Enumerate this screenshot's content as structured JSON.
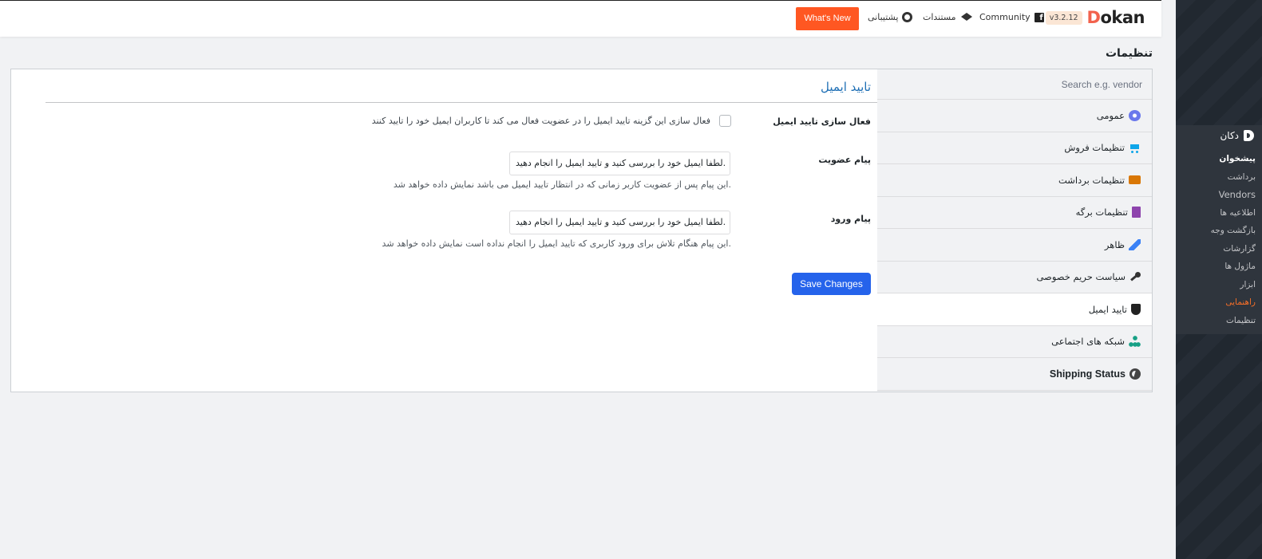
{
  "topbar": {
    "brand_prefix": "D",
    "brand_rest": "okan",
    "version": "v3.2.12",
    "community": "Community",
    "docs": "مستندات",
    "support": "پشتیبانی",
    "whats_new": "What's New"
  },
  "page_title": "تنظیمات",
  "settings_nav": {
    "search_placeholder": "Search e.g. vendor",
    "tabs": [
      {
        "label": "عمومی",
        "icon": "gear-icon"
      },
      {
        "label": "تنظیمات فروش",
        "icon": "cart-icon"
      },
      {
        "label": "تنظیمات برداشت",
        "icon": "withdraw-icon"
      },
      {
        "label": "تنظیمات برگه",
        "icon": "pages-icon"
      },
      {
        "label": "ظاهر",
        "icon": "brush-icon"
      },
      {
        "label": "سیاست حریم خصوصی",
        "icon": "key-icon"
      },
      {
        "label": "تایید ایمیل",
        "icon": "shield-icon",
        "active": true
      },
      {
        "label": "شبکه های اجتماعی",
        "icon": "network-icon"
      },
      {
        "label": "Shipping Status",
        "icon": "globe-icon"
      }
    ]
  },
  "email_verification": {
    "title": "تایید ایمیل",
    "enable_label": "فعال سازی تایید ایمیل",
    "enable_desc": "فعال سازی این گزینه تایید ایمیل را در عضویت فعال می کند تا کاربران ایمیل خود را تایید کنند",
    "enable_checked": false,
    "registration_label": "پیام عضویت",
    "registration_value": "لطفا ایمیل خود را بررسی کنید و تایید ایمیل را انجام دهید.",
    "registration_help": "این پیام پس از عضویت کاربر زمانی که در انتظار تایید ایمیل می باشد نمایش داده خواهد شد.",
    "login_label": "پیام ورود",
    "login_value": "لطفا ایمیل خود را بررسی کنید و تایید ایمیل را انجام دهید.",
    "login_help": "این پیام هنگام تلاش برای ورود کاربری که تایید ایمیل را انجام نداده است نمایش داده خواهد شد.",
    "save_label": "Save Changes"
  },
  "admin_menu": {
    "parent": "دکان",
    "items": [
      {
        "label": "پیشخوان",
        "style": "bold"
      },
      {
        "label": "برداشت"
      },
      {
        "label": "Vendors",
        "style": "ltr"
      },
      {
        "label": "اطلاعیه ها"
      },
      {
        "label": "بازگشت وجه"
      },
      {
        "label": "گزارشات"
      },
      {
        "label": "ماژول ها"
      },
      {
        "label": "ابزار"
      },
      {
        "label": "راهنمایی",
        "style": "active"
      },
      {
        "label": "تنظیمات"
      }
    ]
  },
  "colors": {
    "accent_orange": "#ff5722",
    "primary_blue": "#2563eb",
    "title_blue": "#1e6fb5",
    "sidebar_dark": "#232a33"
  }
}
